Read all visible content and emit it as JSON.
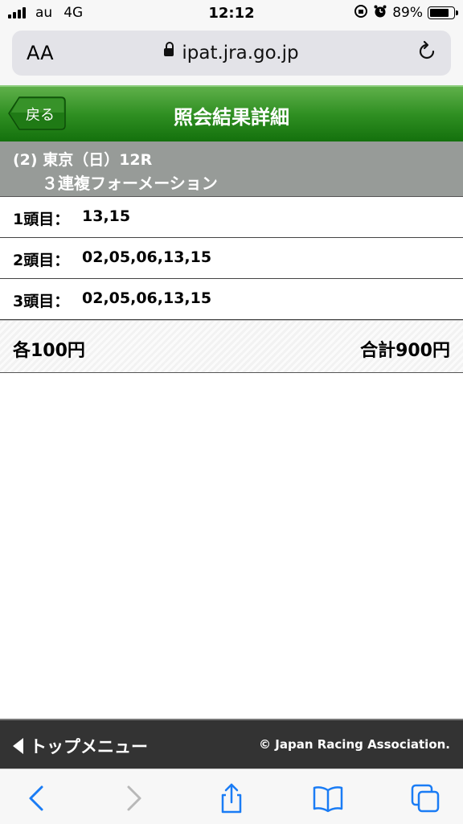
{
  "status_bar": {
    "carrier": "au",
    "network": "4G",
    "time": "12:12",
    "battery": "89%",
    "battery_level": 0.89,
    "icons": [
      "signal-bars-icon",
      "orientation-lock-icon",
      "alarm-icon",
      "battery-icon"
    ]
  },
  "browser": {
    "text_size_label": "AA",
    "url": "ipat.jra.go.jp",
    "icons": [
      "lock-icon",
      "reload-icon"
    ]
  },
  "header": {
    "back_label": "戻る",
    "title": "照会結果詳細"
  },
  "race": {
    "line1": "(2) 東京（日）12R",
    "line2": "３連複フォーメーション"
  },
  "bets": [
    {
      "label": "1頭目：",
      "value": "13,15"
    },
    {
      "label": "2頭目：",
      "value": "02,05,06,13,15"
    },
    {
      "label": "3頭目：",
      "value": "02,05,06,13,15"
    }
  ],
  "summary": {
    "per_bet": "各100円",
    "total": "合計900円"
  },
  "footer": {
    "menu_label": "トップメニュー",
    "copyright": "© Japan Racing Association."
  },
  "toolbar": {
    "icons": [
      "back-icon",
      "forward-icon",
      "share-icon",
      "bookmarks-icon",
      "tabs-icon"
    ]
  },
  "colors": {
    "header_green": "#2f8f22",
    "race_gray": "#979b98",
    "footer_dark": "#333333",
    "ios_blue": "#1a7cf5"
  }
}
